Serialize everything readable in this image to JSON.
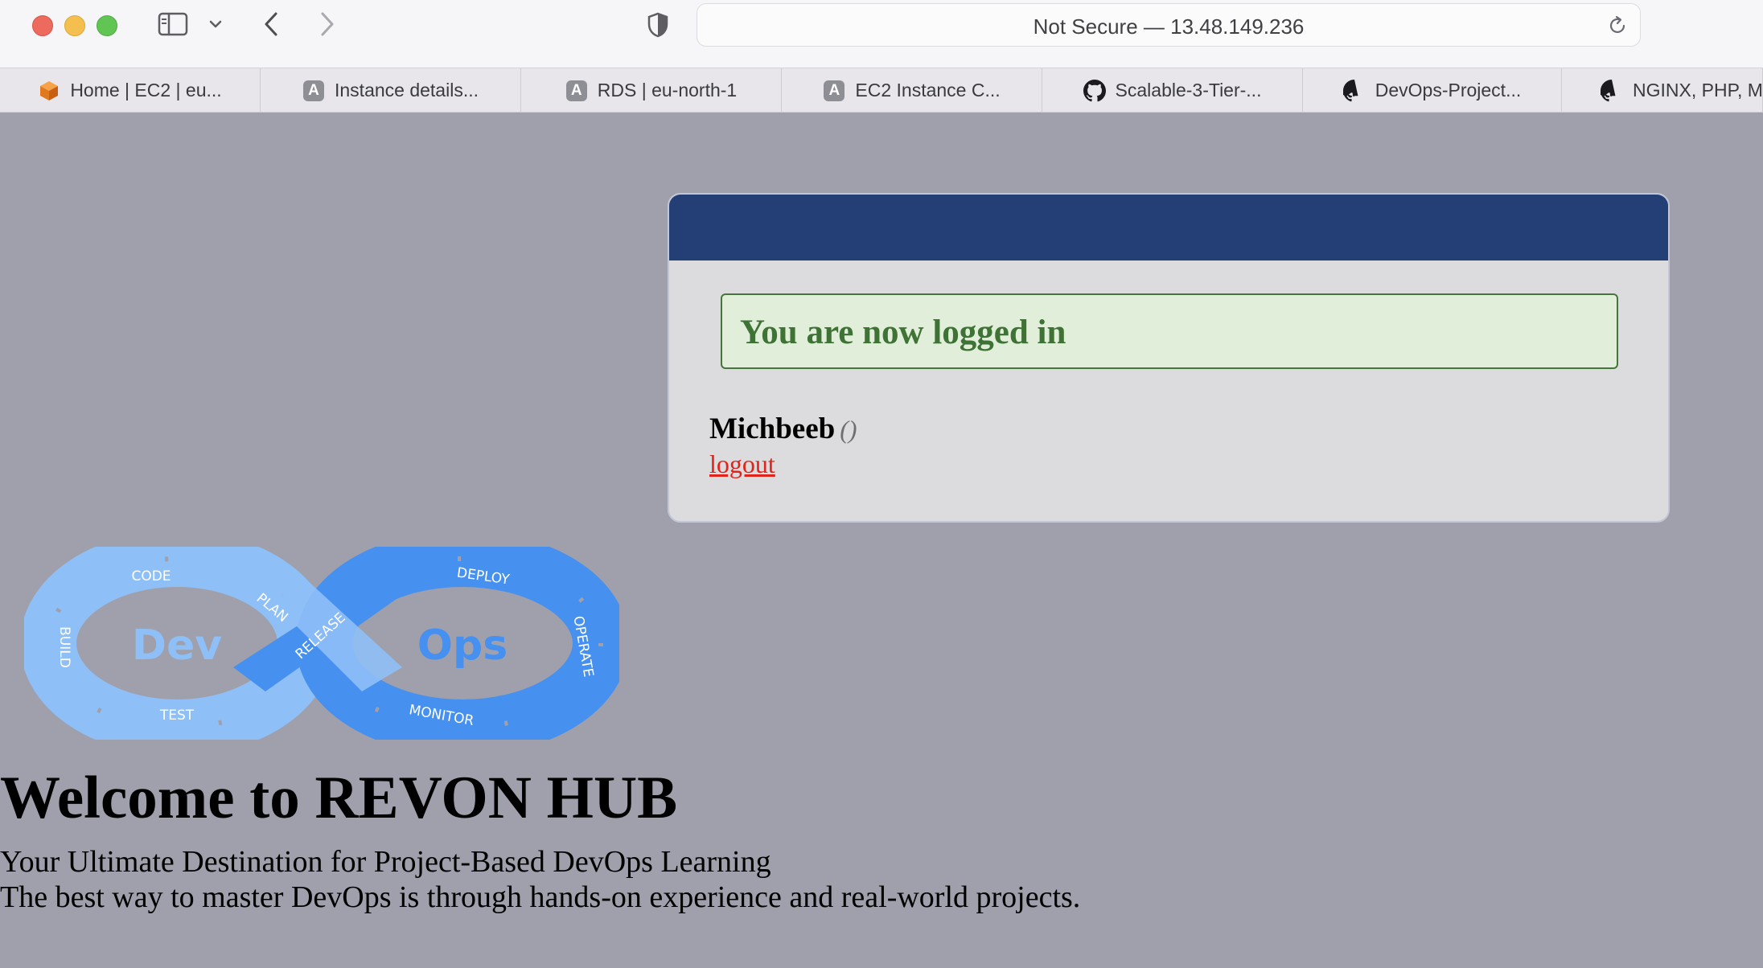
{
  "browser": {
    "url_text": "Not Secure — 13.48.149.236",
    "tabs": [
      {
        "label": "Home | EC2 | eu...",
        "icon": "aws-cube-icon"
      },
      {
        "label": "Instance details...",
        "icon": "letter-a-icon"
      },
      {
        "label": "RDS | eu-north-1",
        "icon": "letter-a-icon"
      },
      {
        "label": "EC2 Instance C...",
        "icon": "letter-a-icon"
      },
      {
        "label": "Scalable-3-Tier-...",
        "icon": "github-icon"
      },
      {
        "label": "DevOps-Project...",
        "icon": "github-icon"
      },
      {
        "label": "NGINX, PHP, M...",
        "icon": "github-icon"
      }
    ],
    "tab_letter": "A"
  },
  "panel": {
    "alert_text": "You are now logged in",
    "username": "Michbeeb",
    "role": "()",
    "logout_label": "logout"
  },
  "logo": {
    "dev": "Dev",
    "ops": "Ops",
    "stages": {
      "code": "CODE",
      "plan": "PLAN",
      "build": "BUILD",
      "test": "TEST",
      "release": "RELEASE",
      "deploy": "DEPLOY",
      "operate": "OPERATE",
      "monitor": "MONITOR"
    }
  },
  "hero": {
    "title": "Welcome to REVON HUB",
    "subtitle": "Your Ultimate Destination for Project-Based DevOps Learning",
    "tagline": "The best way to master DevOps is through hands-on experience and real-world projects."
  },
  "colors": {
    "page_bg": "#9fa0ac",
    "panel_header": "#243f75",
    "alert_bg": "#e1eed9",
    "alert_text": "#3f7335",
    "logout": "#e0241b",
    "devops_light": "#8ebff6",
    "devops_dark": "#4690f0"
  }
}
